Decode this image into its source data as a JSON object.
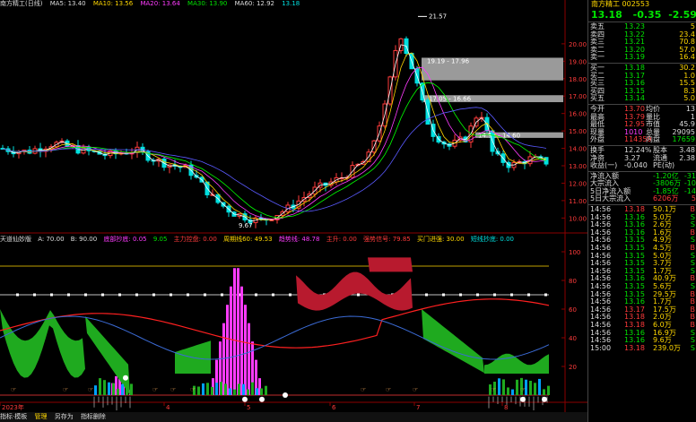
{
  "main_legend": {
    "title": "南方精工(日线)",
    "ma5": "MA5: 13.40",
    "ma10": "MA10: 13.56",
    "ma20": "MA20: 13.64",
    "ma30": "MA30: 13.90",
    "ma60": "MA60: 12.92",
    "extra": "13.18"
  },
  "price_annotations": {
    "high": "21.57",
    "low": "9.67",
    "box1": "19.19 - 17.96",
    "box2": "17.05 - 16.66",
    "box3": "14.92 - 14.60",
    "y_ticks": [
      "20.00",
      "19.00",
      "18.00",
      "17.00",
      "16.00",
      "15.00",
      "14.00",
      "13.00",
      "12.00",
      "11.00",
      "10.00"
    ]
  },
  "indicator_legend": {
    "name": "天道仙妙版",
    "a": "A: 70.00",
    "b": "B: 90.00",
    "i1": "底部抄底: 0.05",
    "i2": "9.05",
    "i3": "主力控盘: 0.00",
    "i4": "周期线60: 49.53",
    "i5": "趋势线: 48.78",
    "i6": "主升: 0.00",
    "i7": "强势信号: 79.85",
    "i8": "买门进强: 30.00",
    "i9": "短线抄底: 0.00",
    "y_ticks": [
      "100",
      "80",
      "60",
      "40",
      "20"
    ]
  },
  "x_axis": [
    "2023年",
    "4",
    "5",
    "6",
    "7",
    "8"
  ],
  "bottom_bar": {
    "tab1": "指标·模板",
    "tab2": "管理",
    "tab3": "另存为",
    "tab4": "指标删除"
  },
  "quote": {
    "title": "南方精工 002553",
    "price": "13.18",
    "change": "-0.35",
    "change_pct": "-2.59%",
    "asks": [
      {
        "label": "卖五",
        "price": "13.23",
        "vol": "5"
      },
      {
        "label": "卖四",
        "price": "13.22",
        "vol": "23.4"
      },
      {
        "label": "卖三",
        "price": "13.21",
        "vol": "70.8"
      },
      {
        "label": "卖二",
        "price": "13.20",
        "vol": "57.0"
      },
      {
        "label": "卖一",
        "price": "13.19",
        "vol": "16.4"
      }
    ],
    "bids": [
      {
        "label": "买一",
        "price": "13.18",
        "vol": "30.2"
      },
      {
        "label": "买二",
        "price": "13.17",
        "vol": "1.0"
      },
      {
        "label": "买三",
        "price": "13.16",
        "vol": "15.5"
      },
      {
        "label": "买四",
        "price": "13.15",
        "vol": "8.3"
      },
      {
        "label": "买五",
        "price": "13.14",
        "vol": "5.0"
      }
    ],
    "stats": [
      {
        "l1": "今开",
        "v1": "13.70",
        "l2": "均价",
        "v2": "13"
      },
      {
        "l1": "最高",
        "v1": "13.79",
        "l2": "量比",
        "v2": "1"
      },
      {
        "l1": "最低",
        "v1": "12.95",
        "l2": "市值",
        "v2": "45.9"
      },
      {
        "l1": "现量",
        "v1": "1010",
        "l2": "总量",
        "v2": "29095"
      },
      {
        "l1": "外盘",
        "v1": "114359",
        "l2": "内盘",
        "v2": "17659"
      }
    ],
    "stats2": [
      {
        "l1": "换手",
        "v1": "12.24%",
        "l2": "股本",
        "v2": "3.48"
      },
      {
        "l1": "净资",
        "v1": "3.27",
        "l2": "流通",
        "v2": "2.38"
      },
      {
        "l1": "收益(一)",
        "v1": "-0.040",
        "l2": "PE(动)",
        "v2": ""
      }
    ],
    "flows": [
      {
        "label": "净流入额",
        "v1": "-1.20亿",
        "v2": "-31"
      },
      {
        "label": "大宗流入",
        "v1": "-3806万",
        "v2": "-10"
      },
      {
        "label": "5日净流入额",
        "v1": "-1.85亿",
        "v2": "-14"
      },
      {
        "label": "5日大宗流入",
        "v1": "6206万",
        "v2": "5"
      }
    ],
    "ticks": [
      {
        "t": "14:56",
        "p": "13.18",
        "v": "50.1万",
        "d": "B"
      },
      {
        "t": "14:56",
        "p": "13.16",
        "v": "5.0万",
        "d": "S"
      },
      {
        "t": "14:56",
        "p": "13.16",
        "v": "2.6万",
        "d": "S"
      },
      {
        "t": "14:56",
        "p": "13.16",
        "v": "1.6万",
        "d": "B"
      },
      {
        "t": "14:56",
        "p": "13.15",
        "v": "4.9万",
        "d": "S"
      },
      {
        "t": "14:56",
        "p": "13.15",
        "v": "4.5万",
        "d": "B"
      },
      {
        "t": "14:56",
        "p": "13.15",
        "v": "5.0万",
        "d": "S"
      },
      {
        "t": "14:56",
        "p": "13.15",
        "v": "3.7万",
        "d": "S"
      },
      {
        "t": "14:56",
        "p": "13.15",
        "v": "1.7万",
        "d": "S"
      },
      {
        "t": "14:56",
        "p": "13.16",
        "v": "40.9万",
        "d": "B"
      },
      {
        "t": "14:56",
        "p": "13.15",
        "v": "5.6万",
        "d": "S"
      },
      {
        "t": "14:56",
        "p": "13.15",
        "v": "29.5万",
        "d": "B"
      },
      {
        "t": "14:56",
        "p": "13.16",
        "v": "1.7万",
        "d": "B"
      },
      {
        "t": "14:56",
        "p": "13.17",
        "v": "17.5万",
        "d": "B"
      },
      {
        "t": "14:56",
        "p": "13.18",
        "v": "2.0万",
        "d": "B"
      },
      {
        "t": "14:56",
        "p": "13.18",
        "v": "6.0万",
        "d": "B"
      },
      {
        "t": "14:56",
        "p": "13.16",
        "v": "16.9万",
        "d": "S"
      },
      {
        "t": "14:56",
        "p": "13.16",
        "v": "9.6万",
        "d": "S"
      },
      {
        "t": "15:00",
        "p": "13.18",
        "v": "239.0万",
        "d": "S"
      }
    ]
  },
  "colors": {
    "up": "#ff3b3b",
    "down": "#00e0e0",
    "bg": "#000000",
    "ma5": "#ffffff",
    "ma10": "#ffd700",
    "ma20": "#ff3bff",
    "ma30": "#00ff00"
  }
}
